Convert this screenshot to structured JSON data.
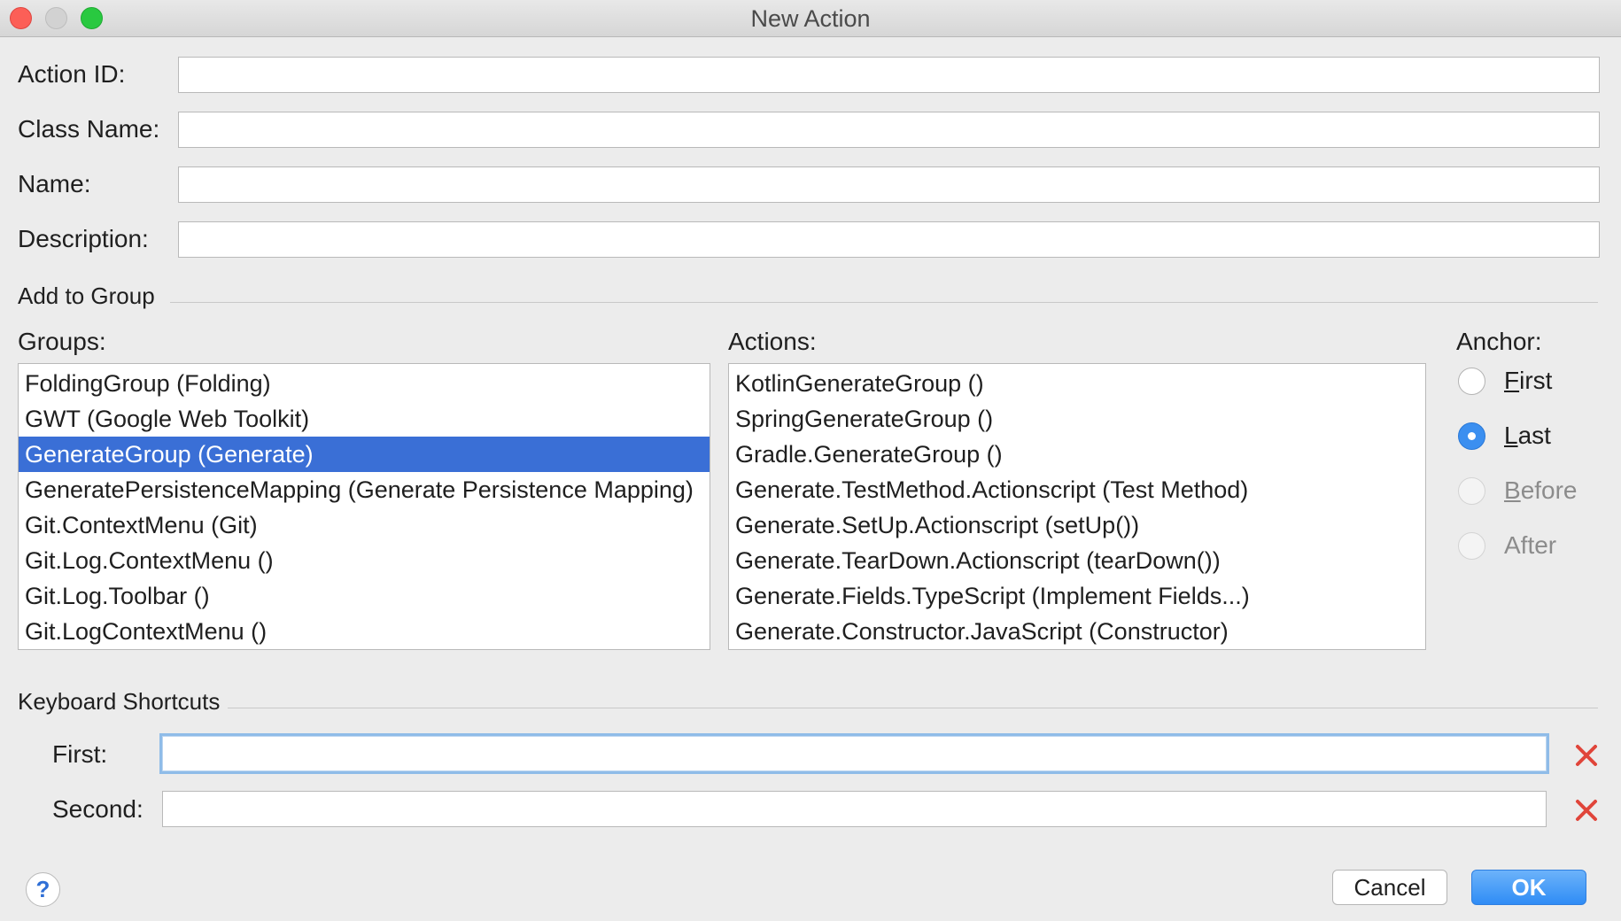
{
  "window": {
    "title": "New Action"
  },
  "form": {
    "action_id_label": "Action ID:",
    "class_name_label": "Class Name:",
    "name_label": "Name:",
    "description_label": "Description:",
    "action_id_value": "",
    "class_name_value": "",
    "name_value": "",
    "description_value": ""
  },
  "add_to_group": {
    "section_title": "Add to Group",
    "groups_label": "Groups:",
    "actions_label": "Actions:",
    "anchor_label": "Anchor:",
    "groups": [
      "FoldingGroup (Folding)",
      "GWT (Google Web Toolkit)",
      "GenerateGroup (Generate)",
      "GeneratePersistenceMapping (Generate Persistence Mapping)",
      "Git.ContextMenu (Git)",
      "Git.Log.ContextMenu ()",
      "Git.Log.Toolbar ()",
      "Git.LogContextMenu ()"
    ],
    "selected_group": "GenerateGroup (Generate)",
    "actions": [
      "KotlinGenerateGroup ()",
      "SpringGenerateGroup ()",
      "Gradle.GenerateGroup ()",
      "Generate.TestMethod.Actionscript (Test Method)",
      "Generate.SetUp.Actionscript (setUp())",
      "Generate.TearDown.Actionscript (tearDown())",
      "Generate.Fields.TypeScript (Implement Fields...)",
      "Generate.Constructor.JavaScript (Constructor)"
    ],
    "anchor_options": [
      {
        "mnemonic": "F",
        "rest": "irst",
        "checked": false,
        "enabled": true
      },
      {
        "mnemonic": "L",
        "rest": "ast",
        "checked": true,
        "enabled": true
      },
      {
        "mnemonic": "B",
        "rest": "efore",
        "checked": false,
        "enabled": false
      },
      {
        "mnemonic": "After",
        "rest": "",
        "checked": false,
        "enabled": false
      }
    ]
  },
  "keyboard_shortcuts": {
    "section_title": "Keyboard Shortcuts",
    "first_label": "First:",
    "second_label": "Second:",
    "first_value": "",
    "second_value": ""
  },
  "buttons": {
    "help": "?",
    "cancel": "Cancel",
    "ok": "OK"
  },
  "colors": {
    "selection": "#3a6fd6",
    "ok_button": "#2f8cf5",
    "clear_icon": "#e0453a"
  }
}
